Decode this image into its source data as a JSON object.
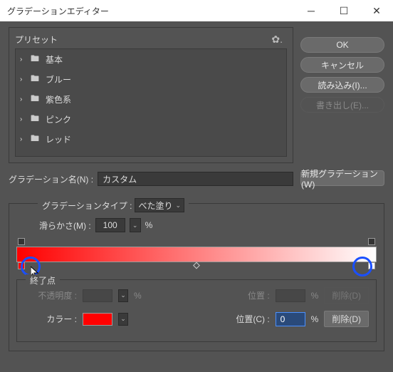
{
  "window": {
    "title": "グラデーションエディター"
  },
  "presets": {
    "label": "プリセット",
    "items": [
      {
        "name": "基本"
      },
      {
        "name": "ブルー"
      },
      {
        "name": "紫色系"
      },
      {
        "name": "ピンク"
      },
      {
        "name": "レッド"
      }
    ]
  },
  "buttons": {
    "ok": "OK",
    "cancel": "キャンセル",
    "import": "読み込み(I)...",
    "export": "書き出し(E)...",
    "new_gradient": "新規グラデーション(W)"
  },
  "gradient": {
    "name_label": "グラデーション名(N) :",
    "name_value": "カスタム",
    "type_label": "グラデーションタイプ :",
    "type_value": "べた塗り",
    "smoothness_label": "滑らかさ(M) :",
    "smoothness_value": "100",
    "smoothness_unit": "%",
    "colors": {
      "start": "#ff0000",
      "end": "#ffffff"
    }
  },
  "endpoints": {
    "title": "終了点",
    "opacity_label": "不透明度 :",
    "opacity_unit": "%",
    "position1_label": "位置 :",
    "position1_unit": "%",
    "delete1_label": "削除(D)",
    "color_label": "カラー :",
    "position2_label": "位置(C) :",
    "position2_value": "0",
    "position2_unit": "%",
    "delete2_label": "削除(D)"
  }
}
